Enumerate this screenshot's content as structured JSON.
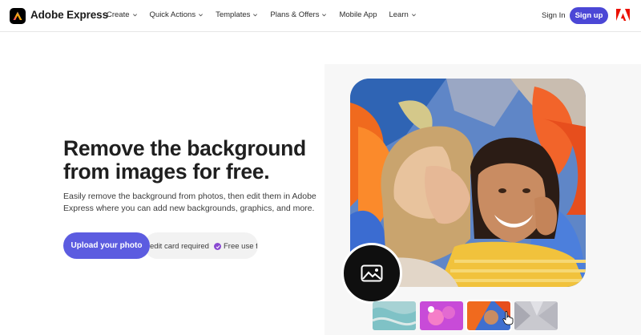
{
  "header": {
    "brand": "Adobe Express",
    "nav": [
      {
        "label": "Create"
      },
      {
        "label": "Quick Actions"
      },
      {
        "label": "Templates"
      },
      {
        "label": "Plans & Offers"
      },
      {
        "label": "Mobile App"
      },
      {
        "label": "Learn"
      }
    ],
    "signin": "Sign In",
    "signup": "Sign up"
  },
  "hero": {
    "headline_line1": "Remove the background",
    "headline_line2": "from images for free.",
    "description": "Easily remove the background from photos, then edit them in Adobe Express where you can add new backgrounds, graphics, and more.",
    "upload_label": "Upload your photo",
    "pill_text1": "edit card required",
    "pill_text2": "Free use fo"
  },
  "colors": {
    "accent": "#5c5ce0",
    "signup": "#4b47d6",
    "check": "#8a4ad1",
    "adobe_red": "#eb1000"
  },
  "icons": {
    "logo": "adobe-express-logo-icon",
    "image": "image-icon",
    "adobe": "adobe-logo-icon"
  }
}
